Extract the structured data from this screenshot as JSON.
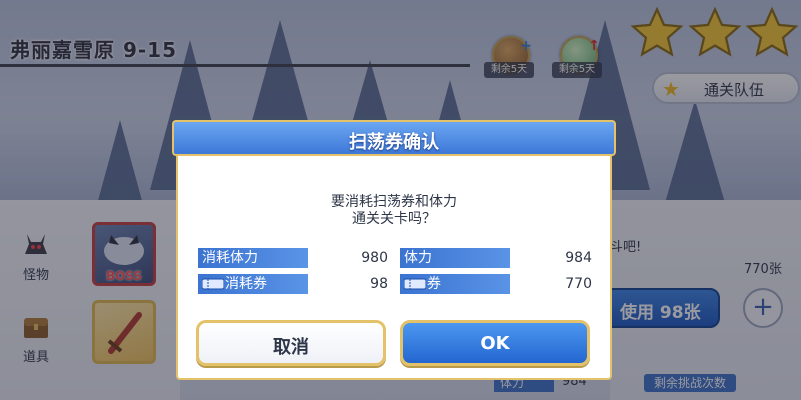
{
  "stage": {
    "title": "弗丽嘉雪原 9-15"
  },
  "items": [
    {
      "icon": "treasure-chest-icon",
      "label": "剩余5天",
      "color": "#8a5a2a"
    },
    {
      "icon": "orb-icon",
      "label": "剩余5天",
      "color": "#7ad08a"
    }
  ],
  "stars": {
    "count": 3,
    "color": "#f5c634"
  },
  "team_button": {
    "label": "通关队伍"
  },
  "left_tabs": [
    {
      "icon": "monster-icon",
      "label": "怪物"
    },
    {
      "icon": "chest-icon",
      "label": "道具"
    }
  ],
  "boss_card": {
    "label": "BOSS"
  },
  "right_panel": {
    "fight_text": "斗吧!",
    "ticket_count": "770张",
    "use_button": "使用 98张",
    "plus": "+"
  },
  "bottom_bar": {
    "stamina_label": "体力",
    "stamina_value": "984",
    "remaining_label": "剩余挑战次数"
  },
  "dialog": {
    "title": "扫荡券确认",
    "message_line1": "要消耗扫荡券和体力",
    "message_line2": "通关关卡吗？",
    "rows": [
      {
        "label": "消耗体力",
        "value": "980"
      },
      {
        "label": "体力",
        "value": "984"
      },
      {
        "label": "消耗券",
        "value": "98"
      },
      {
        "label": "券",
        "value": "770"
      }
    ],
    "cancel": "取消",
    "ok": "OK"
  },
  "colors": {
    "accent_blue": "#3e78d8",
    "gold_border": "#e3c26a",
    "boss_red": "#c43c3c"
  }
}
